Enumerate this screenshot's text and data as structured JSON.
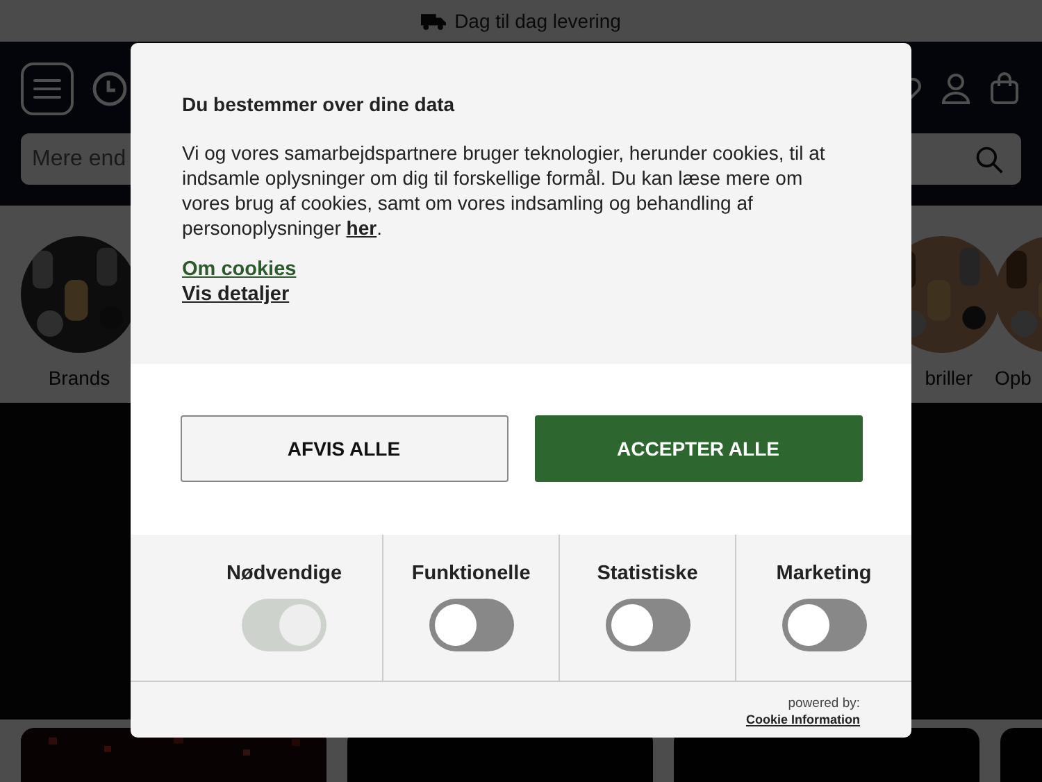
{
  "top_bar": {
    "text": "Dag til dag levering"
  },
  "search": {
    "placeholder": "Mere end"
  },
  "categories": [
    {
      "label": "Brands"
    },
    {
      "label": "briller"
    },
    {
      "label": "Opb"
    }
  ],
  "consent": {
    "title": "Du bestemmer over dine data",
    "body": "Vi og vores samarbejdspartnere bruger teknologier, herunder cookies, til at indsamle oplysninger om dig til forskellige formål. Du kan læse mere om vores brug af cookies, samt om vores indsamling og behandling af personoplysninger ",
    "body_link": "her",
    "body_end": ".",
    "links": [
      "Om cookies",
      "Vis detaljer"
    ],
    "buttons": [
      {
        "label": "AFVIS ALLE",
        "kind": "secondary"
      },
      {
        "label": "ACCEPTER ALLE",
        "kind": "primary"
      }
    ],
    "toggles": [
      {
        "label": "Nødvendige",
        "on": true,
        "disabled": true
      },
      {
        "label": "Funktionelle",
        "on": false,
        "disabled": false
      },
      {
        "label": "Statistiske",
        "on": false,
        "disabled": false
      },
      {
        "label": "Marketing",
        "on": false,
        "disabled": false
      }
    ],
    "powered_by": "powered by:",
    "powered_link": "Cookie Information"
  }
}
